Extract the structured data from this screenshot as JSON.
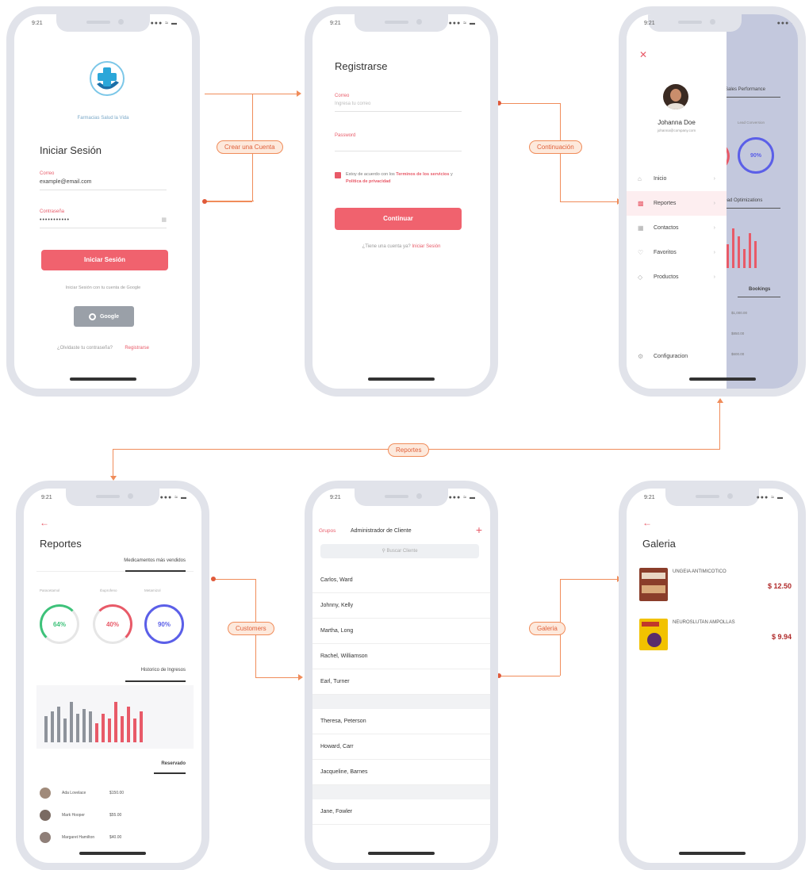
{
  "status": {
    "time": "9:21",
    "icons": "●●● ≈ ▬"
  },
  "connectors": {
    "crear_cuenta": "Crear una Cuenta",
    "continuacion": "Continuación",
    "reportes": "Reportes",
    "customers": "Customers",
    "galeria": "Galeria"
  },
  "login": {
    "logo_caption": "Farmacias Salud la Vida",
    "title": "Iniciar Sesión",
    "email_label": "Correo",
    "email_value": "example@email.com",
    "password_label": "Contraseña",
    "password_value": "•••••••••••",
    "login_button": "Iniciar Sesión",
    "google_hint": "Iniciar Sesión con tu cuenta de Google",
    "google_button": "Google",
    "forgot": "¿Olvidaste tu contraseña?",
    "register": "Registrarse"
  },
  "register": {
    "title": "Registrarse",
    "email_label": "Correo",
    "email_placeholder": "Ingresa tu correo",
    "password_label": "Password",
    "terms_prefix": "Estoy de acuerdo con los ",
    "terms_link": "Terminos de los servicios",
    "terms_mid": " y ",
    "privacy_link": "Politica de privacidad",
    "continue_button": "Continuar",
    "have_account": "¿Tiene una cuenta ya?",
    "login_link": "Iniciar Sesión"
  },
  "drawer": {
    "user_name": "Johanna Doe",
    "user_email": "johanna@company.com",
    "items": [
      {
        "label": "Inicio",
        "icon": "home-icon"
      },
      {
        "label": "Reportes",
        "icon": "report-icon"
      },
      {
        "label": "Contactos",
        "icon": "contacts-icon"
      },
      {
        "label": "Favoritos",
        "icon": "heart-icon"
      },
      {
        "label": "Productos",
        "icon": "box-icon"
      }
    ],
    "settings": "Configuracion",
    "bg_title": "Sales Performance",
    "bg_ring_label": "Lead Conversion",
    "bg_ring_value": "90%",
    "bg_section2": "Lead Optimizations",
    "bg_section3": "Bookings",
    "bg_values": [
      "$1,000.00",
      "$850.00",
      "$600.00"
    ]
  },
  "reportes": {
    "title": "Reportes",
    "tab_top": "Medicamentos más vendidos",
    "rings": [
      {
        "label": "Paracetamol",
        "value": "64%",
        "pct": 64,
        "color": "#3ec27a"
      },
      {
        "label": "Ibuprofeno",
        "value": "40%",
        "pct": 40,
        "color": "#e85a68"
      },
      {
        "label": "Metamizol",
        "value": "90%",
        "pct": 90,
        "color": "#5b5fe8"
      }
    ],
    "tab_mid": "Historico de Ingresos",
    "bars_gray": [
      0.55,
      0.65,
      0.75,
      0.5,
      0.85,
      0.6,
      0.7,
      0.65
    ],
    "bars_red": [
      0.4,
      0.6,
      0.5,
      0.85,
      0.55,
      0.75,
      0.5,
      0.65
    ],
    "tab_bottom": "Reservado",
    "people": [
      {
        "name": "Ada Lovelace",
        "amount": "$150.00"
      },
      {
        "name": "Mark Hooper",
        "amount": "$55.00"
      },
      {
        "name": "Margaret Hamilton",
        "amount": "$40.00"
      }
    ]
  },
  "clientes": {
    "groups_link": "Grupos",
    "title": "Administrador de Cliente",
    "add": "+",
    "search_placeholder": "Buscar Cliente",
    "group1": [
      "Carlos, Ward",
      "Johnny, Kelly",
      "Martha, Long",
      "Rachel, Williamson",
      "Earl, Turner"
    ],
    "group2": [
      "Theresa, Peterson",
      "Howard, Carr",
      "Jacqueline, Barnes"
    ],
    "group3": [
      "Jane, Fowler"
    ]
  },
  "galeria": {
    "title": "Galeria",
    "items": [
      {
        "name": "UNGEIA ANTIMICOTICO",
        "price": "$ 12.50"
      },
      {
        "name": "NEUROSLUTAN AMPOLLAS",
        "price": "$ 9.94"
      }
    ]
  }
}
